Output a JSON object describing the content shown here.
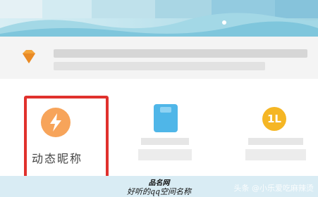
{
  "feature_tiles": [
    {
      "label": "动态昵称",
      "icon": "lightning-icon",
      "highlighted": true
    },
    {
      "label": "",
      "icon": "phone-icon",
      "highlighted": false
    },
    {
      "label": "",
      "icon": "coin-icon",
      "coin_text": "1L",
      "highlighted": false
    }
  ],
  "row_icon": "diamond-icon",
  "colors": {
    "highlight_border": "#e0312d",
    "lightning_bg": "#f7a45a",
    "phone_bg": "#4fb6e8",
    "coin_bg": "#f5b624",
    "footer_bg": "#d9ecf4"
  },
  "caption": {
    "line1": "品名网",
    "line2": "好听的qq空间名称"
  },
  "watermark": "头条 @小乐爱吃麻辣烫"
}
